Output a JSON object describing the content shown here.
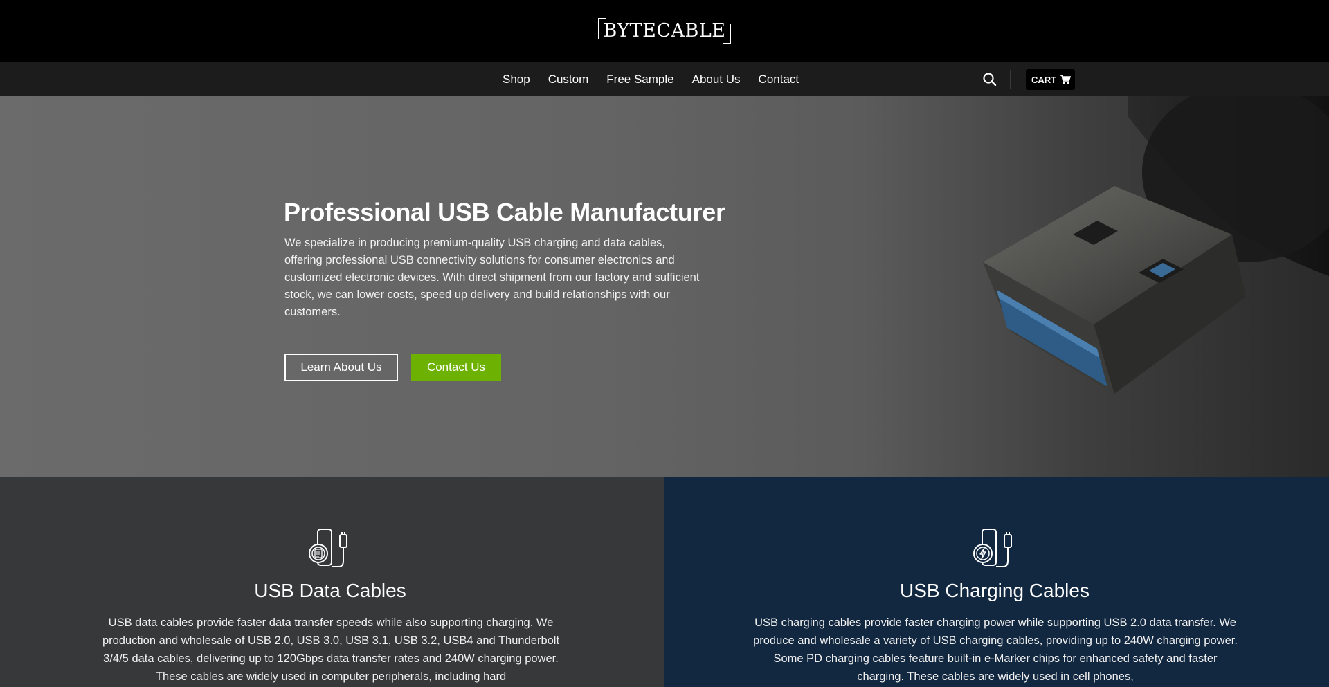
{
  "brand": {
    "logo_text": "BYTECABLE"
  },
  "nav": {
    "items": [
      {
        "label": "Shop"
      },
      {
        "label": "Custom"
      },
      {
        "label": "Free Sample"
      },
      {
        "label": "About Us"
      },
      {
        "label": "Contact"
      }
    ],
    "search_icon": "search-icon",
    "cart_label": "CART",
    "cart_icon": "cart-icon"
  },
  "hero": {
    "title": "Professional USB Cable Manufacturer",
    "description": "We specialize in producing premium-quality USB charging and data cables, offering professional USB connectivity solutions for consumer electronics and customized electronic devices. With direct shipment from our factory and sufficient stock, we can lower costs, speed up delivery and build relationships with our customers.",
    "learn_button": "Learn About Us",
    "contact_button": "Contact Us"
  },
  "features": [
    {
      "icon": "usb-data-cable-icon",
      "title": "USB Data Cables",
      "text": "USB data cables provide faster data transfer speeds while also supporting charging. We production and wholesale of USB 2.0, USB 3.0, USB 3.1, USB 3.2, USB4 and Thunderbolt 3/4/5 data cables, delivering up to 120Gbps data transfer rates and 240W charging power. These cables are widely used in computer peripherals, including hard"
    },
    {
      "icon": "usb-charging-cable-icon",
      "title": "USB Charging Cables",
      "text": "USB charging cables provide faster charging power while supporting USB 2.0 data transfer. We produce and wholesale a variety of USB charging cables, providing up to 240W charging power. Some PD charging cables feature built-in e-Marker chips for enhanced safety and faster charging. These cables are widely used in cell phones,"
    }
  ],
  "colors": {
    "accent_green": "#6db203",
    "feature_left_bg": "#363839",
    "feature_right_bg": "#122740",
    "nav_bg": "#1c1c1c"
  }
}
